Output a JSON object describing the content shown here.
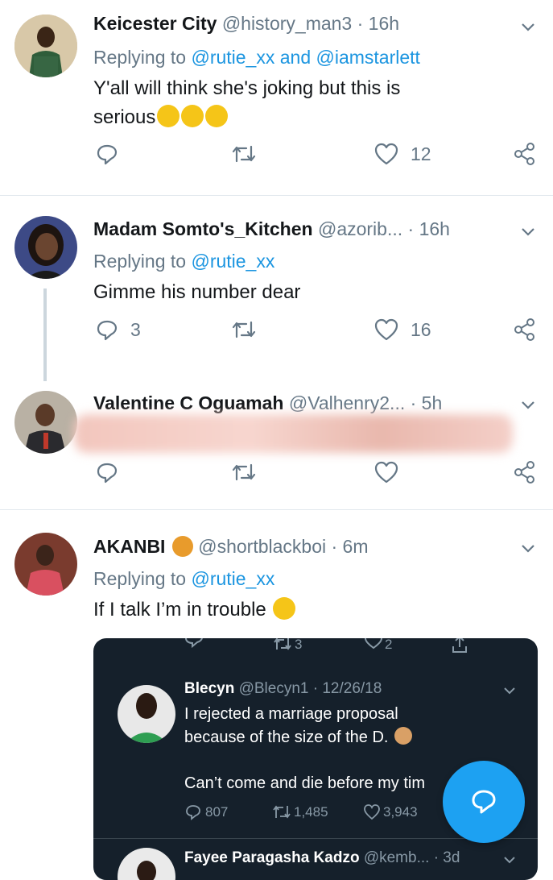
{
  "tweets": [
    {
      "display_name": "Keicester City",
      "handle": "@history_man3",
      "time": "· 16h",
      "replying_prefix": "Replying to",
      "replying_mentions": "@rutie_xx and @iamstarlett",
      "text_line1": "Y'all will think she's joking but this is",
      "text_line2": "serious",
      "reply_count": "",
      "retweet_count": "",
      "like_count": "12"
    },
    {
      "display_name": "Madam Somto's_Kitchen",
      "handle": "@azorib...",
      "time": "· 16h",
      "replying_prefix": "Replying to",
      "replying_mentions": "@rutie_xx",
      "text": "Gimme his number dear",
      "reply_count": "3",
      "retweet_count": "",
      "like_count": "16"
    },
    {
      "display_name": "Valentine C Oguamah",
      "handle": "@Valhenry2...",
      "time": "· 5h",
      "reply_count": "",
      "retweet_count": "",
      "like_count": ""
    },
    {
      "display_name": "AKANBI",
      "handle": "@shortblackboi",
      "time": "· 6m",
      "replying_prefix": "Replying to",
      "replying_mentions": "@rutie_xx",
      "text": "If I talk I’m in trouble"
    }
  ],
  "embedded": {
    "top_retweets": "3",
    "top_likes": "2",
    "quoted": {
      "display_name": "Blecyn",
      "handle_time": "@Blecyn1 · 12/26/18",
      "line1": "I rejected a marriage proposal",
      "line2": "because of the size of the D.",
      "line3": "Can’t come and die before my tim",
      "replies": "807",
      "retweets": "1,485",
      "likes": "3,943"
    },
    "next": {
      "display_name": "Fayee Paragasha Kadzo",
      "handle_time": "@kemb... · 3d"
    }
  },
  "colors": {
    "accent": "#1b95e0",
    "muted": "#657786",
    "dark_bg": "#15202b",
    "fab": "#1da1f2"
  }
}
